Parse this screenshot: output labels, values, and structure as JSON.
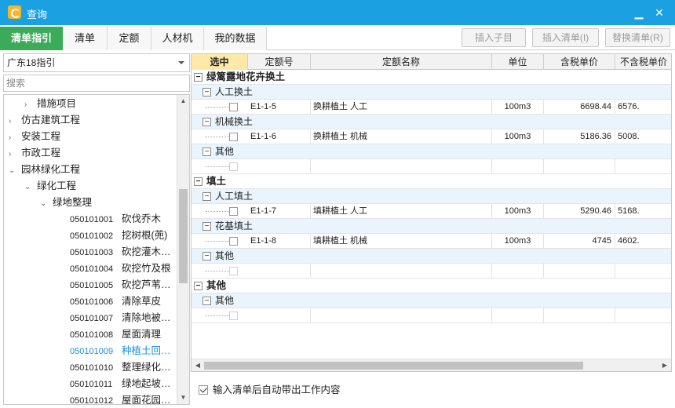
{
  "window": {
    "title": "查询",
    "close_icon": "close-icon",
    "minimize_icon": "minimize-icon"
  },
  "tabs": [
    {
      "label": "清单指引",
      "active": true
    },
    {
      "label": "清单"
    },
    {
      "label": "定额"
    },
    {
      "label": "人材机"
    },
    {
      "label": "我的数据"
    }
  ],
  "toolbar": {
    "insert_child": "插入子目",
    "insert_list": "插入清单(I)",
    "replace_list": "替换清单(R)"
  },
  "left": {
    "guide_select": "广东18指引",
    "search_placeholder": "搜索",
    "tree": [
      {
        "label": "措施项目",
        "level": 1,
        "chevron": "›"
      },
      {
        "label": "仿古建筑工程",
        "level": 0,
        "chevron": "›"
      },
      {
        "label": "安装工程",
        "level": 0,
        "chevron": "›"
      },
      {
        "label": "市政工程",
        "level": 0,
        "chevron": "›"
      },
      {
        "label": "园林绿化工程",
        "level": 0,
        "chevron": "⌄"
      },
      {
        "label": "绿化工程",
        "level": 1,
        "chevron": "⌄"
      },
      {
        "label": "绿地整理",
        "level": 2,
        "chevron": "⌄"
      },
      {
        "code": "050101001",
        "label": "砍伐乔木"
      },
      {
        "code": "050101002",
        "label": "挖树根(蔸)"
      },
      {
        "code": "050101003",
        "label": "砍挖灌木…"
      },
      {
        "code": "050101004",
        "label": "砍挖竹及根"
      },
      {
        "code": "050101005",
        "label": "砍挖芦苇…"
      },
      {
        "code": "050101006",
        "label": "清除草皮"
      },
      {
        "code": "050101007",
        "label": "清除地被…"
      },
      {
        "code": "050101008",
        "label": "屋面清理"
      },
      {
        "code": "050101009",
        "label": "种植土回…",
        "selected": true
      },
      {
        "code": "050101010",
        "label": "整理绿化…"
      },
      {
        "code": "050101011",
        "label": "绿地起坡…"
      },
      {
        "code": "050101012",
        "label": "屋面花园…"
      }
    ]
  },
  "grid": {
    "headers": [
      "选中",
      "定额号",
      "定额名称",
      "单位",
      "含税单价",
      "不含税单价"
    ],
    "rows": [
      {
        "type": "g1",
        "label": "绿篱露地花卉换土"
      },
      {
        "type": "g2",
        "label": "人工换土"
      },
      {
        "type": "d",
        "code": "E1-1-5",
        "name": "换耕植土 人工",
        "unit": "100m3",
        "price_tax": "6698.44",
        "price_notax": "6576."
      },
      {
        "type": "g2",
        "label": "机械换土"
      },
      {
        "type": "d",
        "code": "E1-1-6",
        "name": "换耕植土 机械",
        "unit": "100m3",
        "price_tax": "5186.36",
        "price_notax": "5008."
      },
      {
        "type": "g2",
        "label": "其他"
      },
      {
        "type": "e"
      },
      {
        "type": "g1",
        "label": "填土"
      },
      {
        "type": "g2",
        "label": "人工填土"
      },
      {
        "type": "d",
        "code": "E1-1-7",
        "name": "填耕植土 人工",
        "unit": "100m3",
        "price_tax": "5290.46",
        "price_notax": "5168."
      },
      {
        "type": "g2",
        "label": "花基填土"
      },
      {
        "type": "d",
        "code": "E1-1-8",
        "name": "填耕植土 机械",
        "unit": "100m3",
        "price_tax": "4745",
        "price_notax": "4602."
      },
      {
        "type": "g2",
        "label": "其他"
      },
      {
        "type": "e"
      },
      {
        "type": "g1",
        "label": "其他"
      },
      {
        "type": "g2",
        "label": "其他"
      },
      {
        "type": "e"
      }
    ]
  },
  "footer": {
    "auto_bring_label": "输入清单后自动带出工作内容",
    "checked": true
  }
}
